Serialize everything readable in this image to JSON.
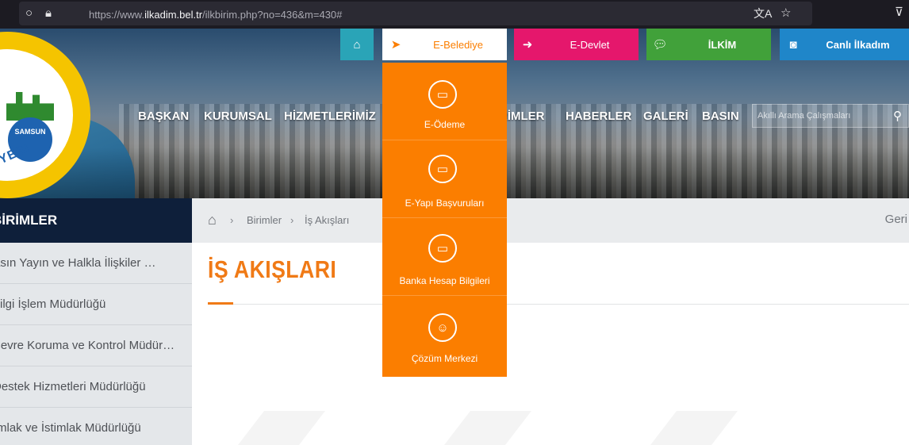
{
  "browser": {
    "url_prefix": "https://www.",
    "url_domain": "ilkadim.bel.tr",
    "url_path": "/ilkbirim.php?no=436&m=430#"
  },
  "logo": {
    "badge": "SAMSUN",
    "arc_text": "IM BELEDIYESI"
  },
  "quick_links": [
    {
      "label": "",
      "icon": "home-icon",
      "color": "#2aa4b7"
    },
    {
      "label": "E-Belediye",
      "icon": "pointer-icon",
      "color": "#ffffff",
      "text_color": "#fb7e00"
    },
    {
      "label": "E-Devlet",
      "icon": "sign-in-icon",
      "color": "#e5176c"
    },
    {
      "label": "İLKİM",
      "icon": "chat-icon",
      "color": "#41a13a"
    },
    {
      "label": "Canlı İlkadım",
      "icon": "camera-icon",
      "color": "#1f86c9"
    }
  ],
  "nav": {
    "items": [
      "BAŞKAN",
      "KURUMSAL",
      "HİZMETLERİMİZ",
      "BİRİMLER",
      "HABERLER",
      "GALERİ",
      "BASIN"
    ],
    "search_placeholder": "Akıllı Arama Çalışmaları"
  },
  "sidebar": {
    "title": "BİRİMLER",
    "items": [
      "Basın Yayın ve Halkla İlişkiler Müdürlüğü",
      "Bilgi İşlem Müdürlüğü",
      "Çevre Koruma ve Kontrol Müdürlüğü",
      "Destek Hizmetleri Müdürlüğü",
      "Emlak ve İstimlak Müdürlüğü"
    ]
  },
  "breadcrumb": {
    "items": [
      "Birimler",
      "İş Akışları"
    ],
    "back": "Geri"
  },
  "page": {
    "title": "İŞ AKIŞLARI"
  },
  "dropdown": {
    "items": [
      {
        "label": "E-Ödeme",
        "icon": "card-icon"
      },
      {
        "label": "E-Yapı Başvuruları",
        "icon": "card-icon"
      },
      {
        "label": "Banka Hesap Bilgileri",
        "icon": "card-icon"
      },
      {
        "label": "Çözüm Merkezi",
        "icon": "support-icon"
      }
    ]
  }
}
